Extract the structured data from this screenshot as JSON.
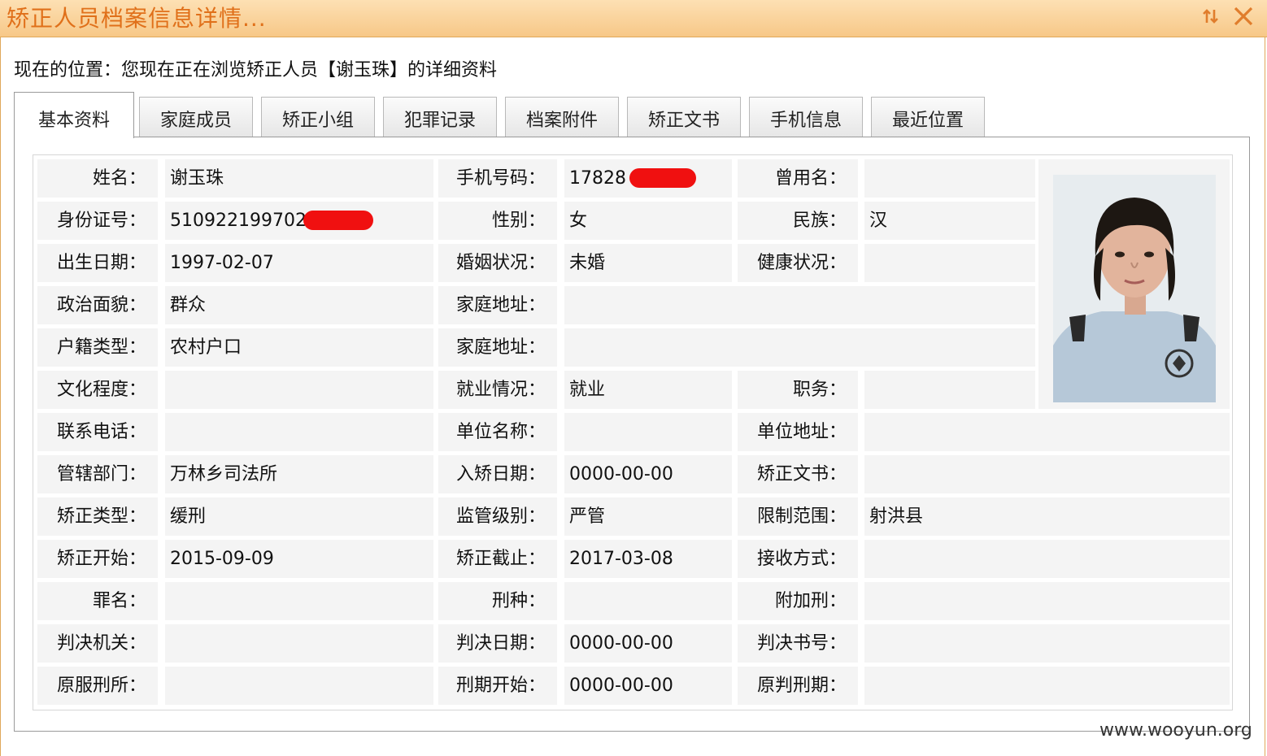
{
  "window": {
    "title": "矫正人员档案信息详情...",
    "sort_icon": "sort-arrows-icon",
    "close_icon": "close-icon"
  },
  "location": "现在的位置：您现在正在浏览矫正人员【谢玉珠】的详细资料",
  "tabs": [
    "基本资料",
    "家庭成员",
    "矫正小组",
    "犯罪记录",
    "档案附件",
    "矫正文书",
    "手机信息",
    "最近位置"
  ],
  "fields": {
    "name_label": "姓名：",
    "name": "谢玉珠",
    "phone_label": "手机号码：",
    "phone": "17828",
    "former_name_label": "曾用名：",
    "former_name": "",
    "id_label": "身份证号：",
    "id_number": "510922199702",
    "gender_label": "性别：",
    "gender": "女",
    "ethnicity_label": "民族：",
    "ethnicity": "汉",
    "birth_label": "出生日期：",
    "birth": "1997-02-07",
    "marital_label": "婚姻状况：",
    "marital": "未婚",
    "health_label": "健康状况：",
    "health": "",
    "political_label": "政治面貌：",
    "political": "群众",
    "home_address_label": "家庭地址：",
    "home_address": "",
    "hukou_label": "户籍类型：",
    "hukou": "农村户口",
    "home_address2_label": "家庭地址：",
    "home_address2": "",
    "education_label": "文化程度：",
    "education": "",
    "employment_label": "就业情况：",
    "employment": "就业",
    "position_label": "职务：",
    "position": "",
    "contact_label": "联系电话：",
    "contact": "",
    "employer_label": "单位名称：",
    "employer": "",
    "employer_addr_label": "单位地址：",
    "employer_addr": "",
    "dept_label": "管辖部门：",
    "dept": "万林乡司法所",
    "entry_label": "入矫日期：",
    "entry": "0000-00-00",
    "doc_label": "矫正文书：",
    "doc": "",
    "type_label": "矫正类型：",
    "type": "缓刑",
    "level_label": "监管级别：",
    "level": "严管",
    "scope_label": "限制范围：",
    "scope": "射洪县",
    "start_label": "矫正开始：",
    "start": "2015-09-09",
    "end_label": "矫正截止：",
    "end": "2017-03-08",
    "receive_label": "接收方式：",
    "receive": "",
    "crime_label": "罪名：",
    "crime": "",
    "penalty_label": "刑种：",
    "penalty": "",
    "extra_label": "附加刑：",
    "extra": "",
    "court_label": "判决机关：",
    "court": "",
    "verdict_date_label": "判决日期：",
    "verdict_date": "0000-00-00",
    "verdict_no_label": "判决书号：",
    "verdict_no": "",
    "prison_label": "原服刑所：",
    "prison": "",
    "term_start_label": "刑期开始：",
    "term_start": "0000-00-00",
    "orig_term_label": "原判刑期：",
    "orig_term": ""
  },
  "colors": {
    "title": "#e0701a",
    "redaction": "#f01010"
  },
  "watermark": "www.wooyun.org"
}
